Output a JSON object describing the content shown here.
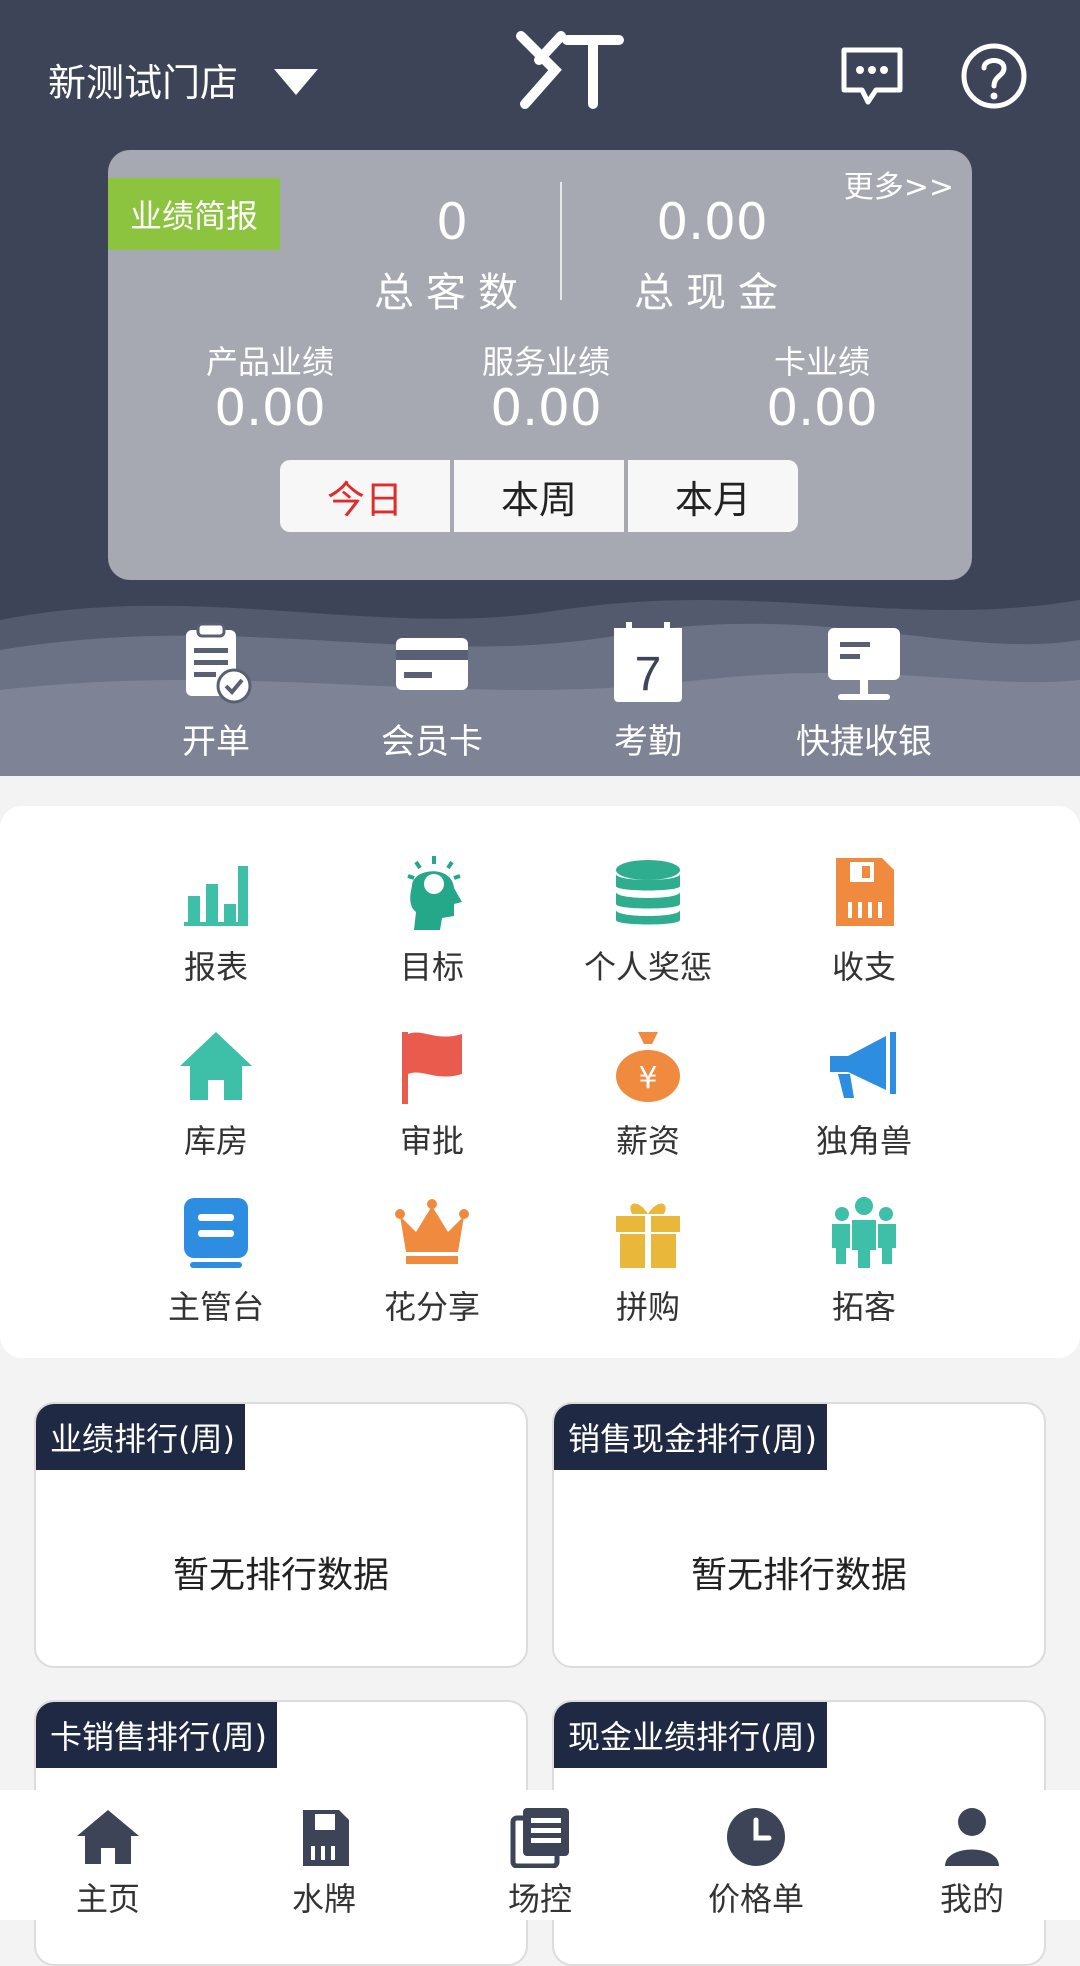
{
  "header": {
    "store_name": "新测试门店",
    "logo_text": "XT"
  },
  "stats": {
    "badge": "业绩简报",
    "more": "更多>>",
    "total_customers_value": "0",
    "total_customers_label": "总客数",
    "total_cash_value": "0.00",
    "total_cash_label": "总现金",
    "product_label": "产品业绩",
    "product_value": "0.00",
    "service_label": "服务业绩",
    "service_value": "0.00",
    "card_label": "卡业绩",
    "card_value": "0.00",
    "periods": [
      "今日",
      "本周",
      "本月"
    ],
    "active_period": "今日"
  },
  "quick_actions": [
    {
      "label": "开单",
      "icon": "clipboard-check-icon"
    },
    {
      "label": "会员卡",
      "icon": "card-icon"
    },
    {
      "label": "考勤",
      "icon": "calendar-icon"
    },
    {
      "label": "快捷收银",
      "icon": "cashier-monitor-icon"
    }
  ],
  "grid": [
    {
      "label": "报表",
      "icon": "bar-chart-icon",
      "color": "#3dbfa8"
    },
    {
      "label": "目标",
      "icon": "head-idea-icon",
      "color": "#25a78a"
    },
    {
      "label": "个人奖惩",
      "icon": "coin-stack-icon",
      "color": "#2fae8f"
    },
    {
      "label": "收支",
      "icon": "sd-card-icon",
      "color": "#f08a3e"
    },
    {
      "label": "库房",
      "icon": "house-icon",
      "color": "#3dbfa8"
    },
    {
      "label": "审批",
      "icon": "flag-icon",
      "color": "#ea5a4d"
    },
    {
      "label": "薪资",
      "icon": "money-bag-icon",
      "color": "#f08a3e"
    },
    {
      "label": "独角兽",
      "icon": "megaphone-icon",
      "color": "#2d8de0"
    },
    {
      "label": "主管台",
      "icon": "desk-icon",
      "color": "#2d8de0"
    },
    {
      "label": "花分享",
      "icon": "crown-icon",
      "color": "#f08a3e"
    },
    {
      "label": "拼购",
      "icon": "gift-icon",
      "color": "#e9b739"
    },
    {
      "label": "拓客",
      "icon": "team-icon",
      "color": "#3dbfa8"
    }
  ],
  "rankings": [
    {
      "title": "业绩排行(周)",
      "empty": "暂无排行数据"
    },
    {
      "title": "销售现金排行(周)",
      "empty": "暂无排行数据"
    },
    {
      "title": "卡销售排行(周)",
      "empty": ""
    },
    {
      "title": "现金业绩排行(周)",
      "empty": ""
    }
  ],
  "tabs": [
    {
      "label": "主页",
      "icon": "home-icon"
    },
    {
      "label": "水牌",
      "icon": "sd-card-icon"
    },
    {
      "label": "场控",
      "icon": "documents-icon"
    },
    {
      "label": "价格单",
      "icon": "clock-icon"
    },
    {
      "label": "我的",
      "icon": "user-icon"
    }
  ],
  "colors": {
    "header_bg": "#3d4458",
    "card_bg": "#a6a9b1",
    "badge_green": "#8cc43f",
    "rank_title_bg": "#1f2943",
    "active_red": "#e02b2b",
    "tab_icon": "#3d4458"
  }
}
